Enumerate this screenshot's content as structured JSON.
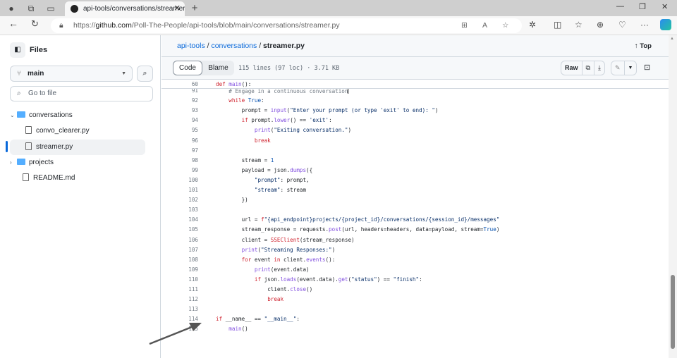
{
  "browser": {
    "tab_title": "api-tools/conversations/streamer.py",
    "url_prefix": "https://",
    "url_host": "github.com",
    "url_path": "/Poll-The-People/api-tools/blob/main/conversations/streamer.py"
  },
  "sidebar": {
    "title": "Files",
    "branch": "main",
    "goto_placeholder": "Go to file",
    "tree": [
      {
        "label": "conversations",
        "type": "folder",
        "expanded": true,
        "depth": 0
      },
      {
        "label": "convo_clearer.py",
        "type": "file",
        "depth": 1
      },
      {
        "label": "streamer.py",
        "type": "file",
        "depth": 1,
        "selected": true
      },
      {
        "label": "projects",
        "type": "folder",
        "expanded": false,
        "depth": 0
      },
      {
        "label": "README.md",
        "type": "file",
        "depth": 0
      }
    ]
  },
  "breadcrumb": {
    "repo": "api-tools",
    "sep": "/",
    "folder": "conversations",
    "file": "streamer.py"
  },
  "top_label": "Top",
  "toolbar": {
    "code": "Code",
    "blame": "Blame",
    "meta": "115 lines (97 loc) · 3.71 KB",
    "raw": "Raw"
  },
  "sticky_line": {
    "n": "60",
    "tokens": [
      [
        "kw",
        "def "
      ],
      [
        "fn",
        "main"
      ],
      [
        "pl",
        "():"
      ]
    ]
  },
  "code": [
    {
      "n": "91",
      "i": 1,
      "t": [
        [
          "cm",
          "# Engage in a continuous conversation"
        ]
      ],
      "cursor": true
    },
    {
      "n": "92",
      "i": 1,
      "t": [
        [
          "kw",
          "while "
        ],
        [
          "num",
          "True"
        ],
        [
          "pl",
          ":"
        ]
      ]
    },
    {
      "n": "93",
      "i": 2,
      "t": [
        [
          "pl",
          "prompt = "
        ],
        [
          "fn",
          "input"
        ],
        [
          "pl",
          "("
        ],
        [
          "str",
          "\"Enter your prompt (or type 'exit' to end): \""
        ],
        [
          "pl",
          ")"
        ]
      ]
    },
    {
      "n": "94",
      "i": 2,
      "t": [
        [
          "kw",
          "if "
        ],
        [
          "pl",
          "prompt."
        ],
        [
          "fn",
          "lower"
        ],
        [
          "pl",
          "() == "
        ],
        [
          "str",
          "'exit'"
        ],
        [
          "pl",
          ":"
        ]
      ]
    },
    {
      "n": "95",
      "i": 3,
      "t": [
        [
          "fn",
          "print"
        ],
        [
          "pl",
          "("
        ],
        [
          "str",
          "\"Exiting conversation.\""
        ],
        [
          "pl",
          ")"
        ]
      ]
    },
    {
      "n": "96",
      "i": 3,
      "t": [
        [
          "kw",
          "break"
        ]
      ]
    },
    {
      "n": "97",
      "i": 0,
      "t": []
    },
    {
      "n": "98",
      "i": 2,
      "t": [
        [
          "pl",
          "stream = "
        ],
        [
          "num",
          "1"
        ]
      ]
    },
    {
      "n": "99",
      "i": 2,
      "t": [
        [
          "pl",
          "payload = json."
        ],
        [
          "fn",
          "dumps"
        ],
        [
          "pl",
          "({"
        ]
      ]
    },
    {
      "n": "100",
      "i": 3,
      "t": [
        [
          "str",
          "\"prompt\""
        ],
        [
          "pl",
          ": prompt,"
        ]
      ]
    },
    {
      "n": "101",
      "i": 3,
      "t": [
        [
          "str",
          "\"stream\""
        ],
        [
          "pl",
          ": stream"
        ]
      ]
    },
    {
      "n": "102",
      "i": 2,
      "t": [
        [
          "pl",
          "})"
        ]
      ]
    },
    {
      "n": "103",
      "i": 0,
      "t": []
    },
    {
      "n": "104",
      "i": 2,
      "t": [
        [
          "pl",
          "url = "
        ],
        [
          "kw",
          "f"
        ],
        [
          "str",
          "\"{api_endpoint}projects/{project_id}/conversations/{session_id}/messages\""
        ]
      ]
    },
    {
      "n": "105",
      "i": 2,
      "t": [
        [
          "pl",
          "stream_response = requests."
        ],
        [
          "fn",
          "post"
        ],
        [
          "pl",
          "(url, headers=headers, data=payload, stream="
        ],
        [
          "num",
          "True"
        ],
        [
          "pl",
          ")"
        ]
      ]
    },
    {
      "n": "106",
      "i": 2,
      "t": [
        [
          "pl",
          "client = "
        ],
        [
          "kw",
          "SSEClient"
        ],
        [
          "pl",
          "(stream_response)"
        ]
      ]
    },
    {
      "n": "107",
      "i": 2,
      "t": [
        [
          "fn",
          "print"
        ],
        [
          "pl",
          "("
        ],
        [
          "str",
          "\"Streaming Responses:\""
        ],
        [
          "pl",
          ")"
        ]
      ]
    },
    {
      "n": "108",
      "i": 2,
      "t": [
        [
          "kw",
          "for "
        ],
        [
          "pl",
          "event "
        ],
        [
          "kw",
          "in "
        ],
        [
          "pl",
          "client."
        ],
        [
          "fn",
          "events"
        ],
        [
          "pl",
          "():"
        ]
      ]
    },
    {
      "n": "109",
      "i": 3,
      "t": [
        [
          "fn",
          "print"
        ],
        [
          "pl",
          "(event.data)"
        ]
      ]
    },
    {
      "n": "110",
      "i": 3,
      "t": [
        [
          "kw",
          "if "
        ],
        [
          "pl",
          "json."
        ],
        [
          "fn",
          "loads"
        ],
        [
          "pl",
          "(event.data)."
        ],
        [
          "fn",
          "get"
        ],
        [
          "pl",
          "("
        ],
        [
          "str",
          "\"status\""
        ],
        [
          "pl",
          ") == "
        ],
        [
          "str",
          "\"finish\""
        ],
        [
          "pl",
          ":"
        ]
      ]
    },
    {
      "n": "111",
      "i": 4,
      "t": [
        [
          "pl",
          "client."
        ],
        [
          "fn",
          "close"
        ],
        [
          "pl",
          "()"
        ]
      ]
    },
    {
      "n": "112",
      "i": 4,
      "t": [
        [
          "kw",
          "break"
        ]
      ]
    },
    {
      "n": "113",
      "i": 0,
      "t": []
    },
    {
      "n": "114",
      "i": 0,
      "t": [
        [
          "kw",
          "if "
        ],
        [
          "pl",
          "__name__ == "
        ],
        [
          "str",
          "\"__main__\""
        ],
        [
          "pl",
          ":"
        ]
      ]
    },
    {
      "n": "115",
      "i": 1,
      "t": [
        [
          "fn",
          "main"
        ],
        [
          "pl",
          "()"
        ]
      ]
    }
  ]
}
